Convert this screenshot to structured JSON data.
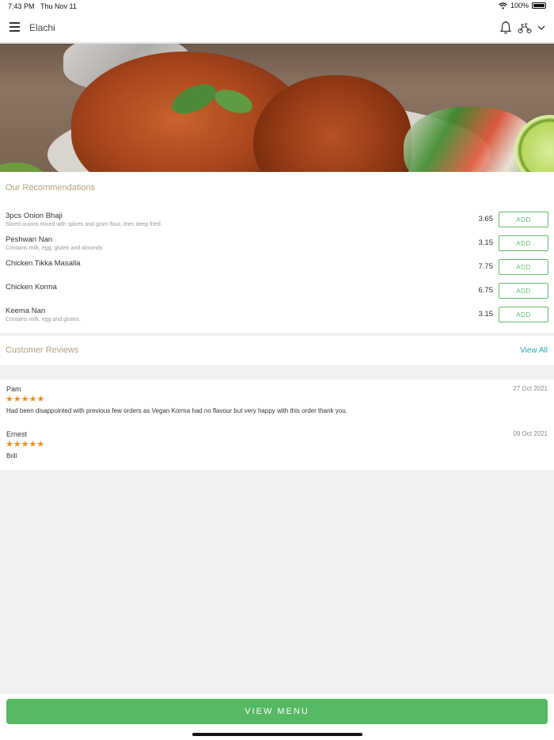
{
  "status": {
    "time": "7:43 PM",
    "date": "Thu Nov 11",
    "battery": "100%"
  },
  "nav": {
    "title": "Elachi",
    "icons": [
      "menu-icon",
      "bell-icon",
      "scooter-icon",
      "chevron-down-icon"
    ]
  },
  "recommendations": {
    "title": "Our Recommendations",
    "add_label": "ADD",
    "items": [
      {
        "name": "3pcs Onion Bhaji",
        "desc": "Sliced onions mixed with spices and gram flour, then deep fried.",
        "price": "3.65"
      },
      {
        "name": "Peshwari Nan",
        "desc": "Contains milk, egg, gluten and almonds",
        "price": "3.15"
      },
      {
        "name": "Chicken Tikka Masalla",
        "desc": "",
        "price": "7.75"
      },
      {
        "name": "Chicken Korma",
        "desc": "",
        "price": "6.75"
      },
      {
        "name": "Keema Nan",
        "desc": "Contains milk, egg and gluten.",
        "price": "3.15"
      }
    ]
  },
  "reviews": {
    "title": "Customer Reviews",
    "view_all": "View All",
    "items": [
      {
        "author": "Pam",
        "date": "27 Oct 2021",
        "stars": "★★★★★",
        "rating": 5,
        "text": "Had been disappointed with previous few orders as Vegan Korma had no flavour but very happy with this order thank you."
      },
      {
        "author": "Ernest",
        "date": "09 Oct 2021",
        "stars": "★★★★★",
        "rating": 5,
        "text": "Brill"
      }
    ]
  },
  "footer": {
    "view_menu": "VIEW MENU"
  },
  "colors": {
    "accent_green": "#56b862",
    "section_title": "#b3a27c",
    "link": "#2aa6b8",
    "star": "#f08a1c"
  }
}
